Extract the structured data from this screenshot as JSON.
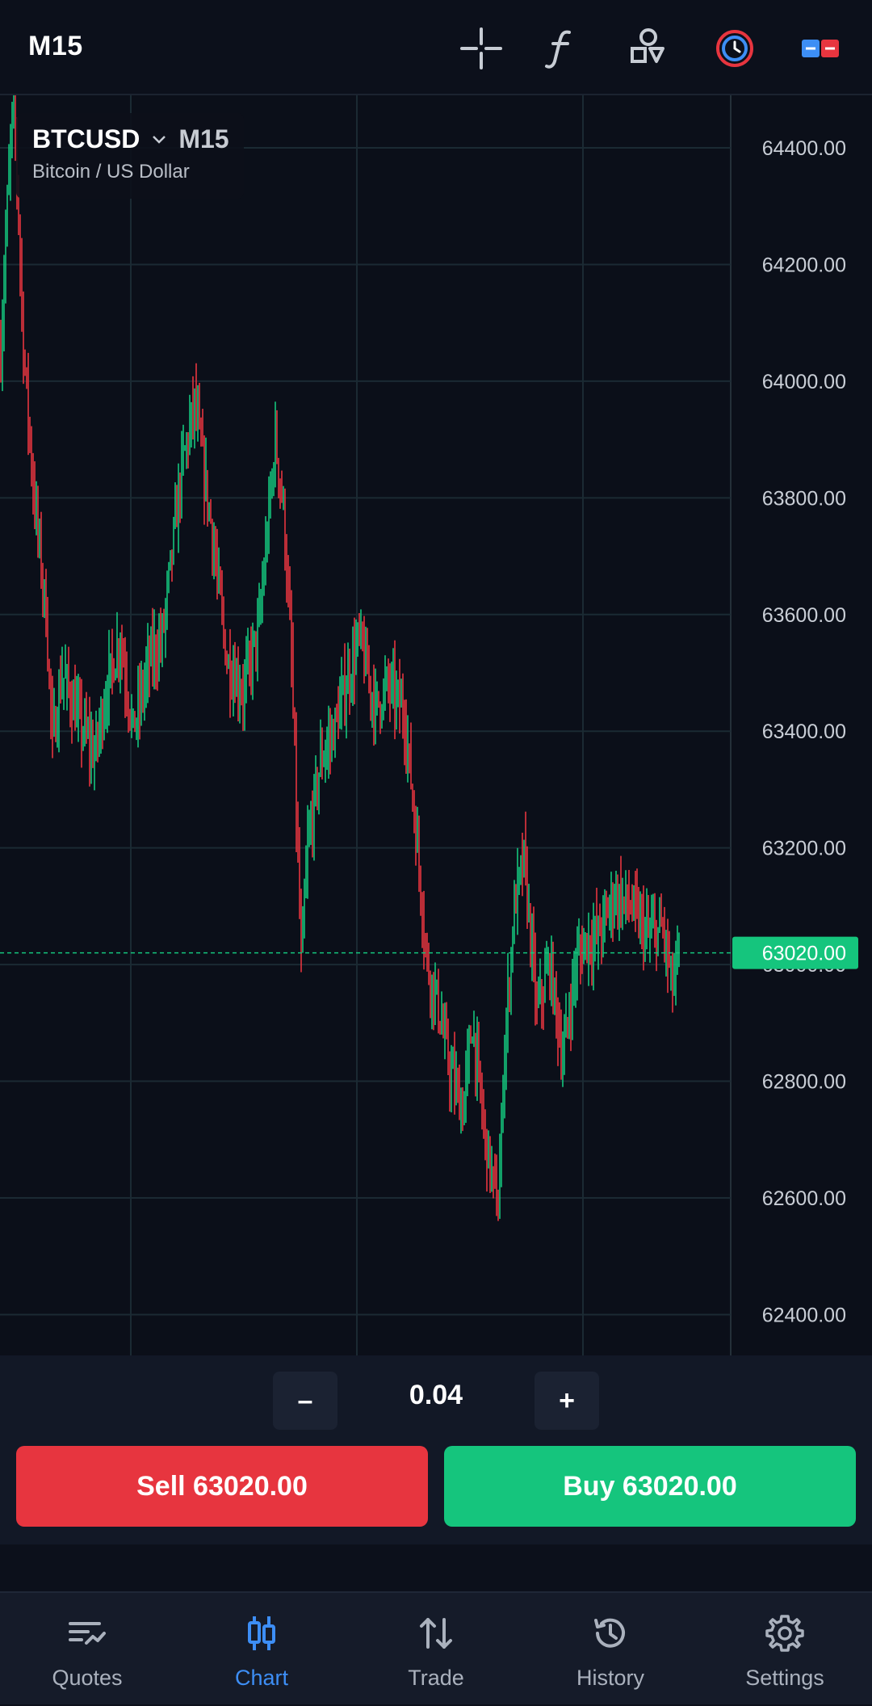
{
  "header": {
    "timeframe_label": "M15",
    "icons": [
      "crosshair-icon",
      "function-icon",
      "objects-icon",
      "clock-icon",
      "toggle-icon"
    ]
  },
  "symbol": {
    "name": "BTCUSD",
    "timeframe": "M15",
    "description": "Bitcoin / US Dollar"
  },
  "price_axis": {
    "labels": [
      "64400.00",
      "64200.00",
      "64000.00",
      "63800.00",
      "63600.00",
      "63400.00",
      "63200.00",
      "63000.00",
      "62800.00",
      "62600.00",
      "62400.00"
    ],
    "current_price": "63020.00"
  },
  "colors": {
    "up": "#15c57d",
    "down": "#e7353f",
    "grid": "#1b2a33",
    "accent": "#3d8ef5"
  },
  "chart_data": {
    "type": "candlestick",
    "symbol": "BTCUSD",
    "timeframe": "M15",
    "ylim": [
      62330,
      64490
    ],
    "y_ticks": [
      64400,
      64200,
      64000,
      63800,
      63600,
      63400,
      63200,
      63000,
      62800,
      62600,
      62400
    ],
    "current_price": 63020,
    "grid": true,
    "path": [
      [
        0,
        64050
      ],
      [
        3,
        64250
      ],
      [
        8,
        64500
      ],
      [
        14,
        64060
      ],
      [
        20,
        63820
      ],
      [
        28,
        63600
      ],
      [
        32,
        63380
      ],
      [
        38,
        63500
      ],
      [
        48,
        63420
      ],
      [
        58,
        63360
      ],
      [
        66,
        63480
      ],
      [
        74,
        63560
      ],
      [
        82,
        63400
      ],
      [
        92,
        63520
      ],
      [
        100,
        63560
      ],
      [
        112,
        63850
      ],
      [
        120,
        63960
      ],
      [
        130,
        63760
      ],
      [
        140,
        63520
      ],
      [
        150,
        63470
      ],
      [
        160,
        63580
      ],
      [
        170,
        63900
      ],
      [
        175,
        63780
      ],
      [
        180,
        63520
      ],
      [
        186,
        63000
      ],
      [
        190,
        63200
      ],
      [
        198,
        63350
      ],
      [
        206,
        63400
      ],
      [
        214,
        63480
      ],
      [
        222,
        63560
      ],
      [
        232,
        63440
      ],
      [
        240,
        63480
      ],
      [
        250,
        63430
      ],
      [
        258,
        63200
      ],
      [
        264,
        63000
      ],
      [
        270,
        62940
      ],
      [
        278,
        62820
      ],
      [
        286,
        62750
      ],
      [
        292,
        62900
      ],
      [
        300,
        62700
      ],
      [
        308,
        62580
      ],
      [
        312,
        62860
      ],
      [
        318,
        63100
      ],
      [
        324,
        63180
      ],
      [
        332,
        62920
      ],
      [
        340,
        63000
      ],
      [
        348,
        62840
      ],
      [
        356,
        63000
      ],
      [
        362,
        63040
      ],
      [
        370,
        63050
      ],
      [
        380,
        63120
      ],
      [
        390,
        63100
      ],
      [
        400,
        63050
      ],
      [
        410,
        63060
      ],
      [
        416,
        62960
      ],
      [
        420,
        63020
      ]
    ]
  },
  "order": {
    "minus_label": "–",
    "lot_value": "0.04",
    "plus_label": "+",
    "sell_label": "Sell 63020.00",
    "buy_label": "Buy 63020.00"
  },
  "nav": {
    "items": [
      {
        "label": "Quotes",
        "icon": "quotes-icon"
      },
      {
        "label": "Chart",
        "icon": "chart-icon",
        "active": true
      },
      {
        "label": "Trade",
        "icon": "trade-icon"
      },
      {
        "label": "History",
        "icon": "history-icon"
      },
      {
        "label": "Settings",
        "icon": "settings-icon"
      }
    ]
  }
}
